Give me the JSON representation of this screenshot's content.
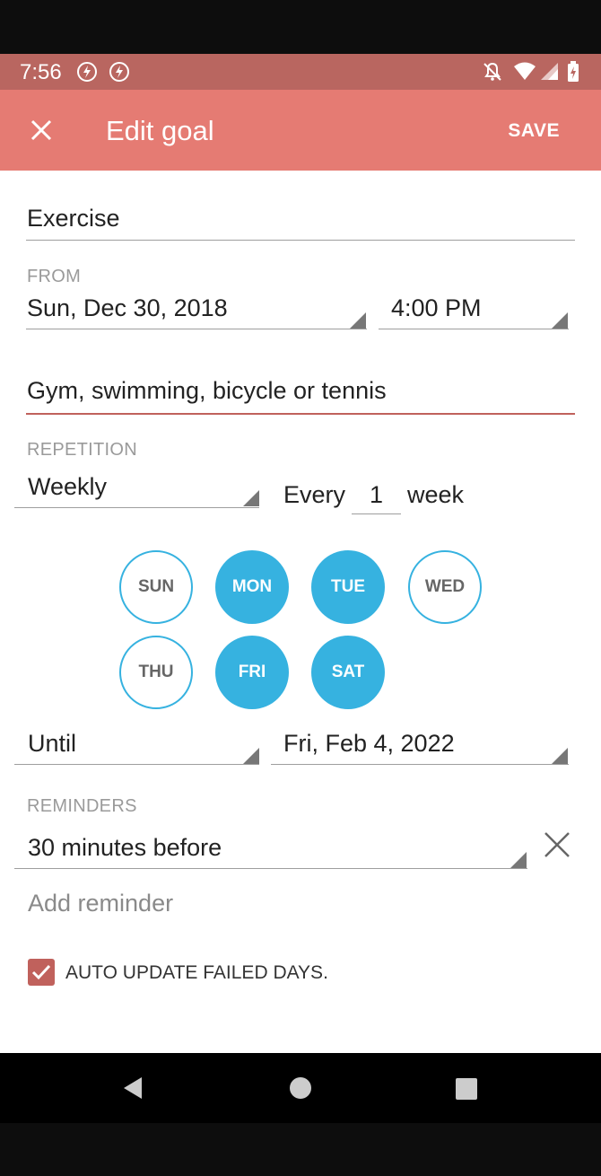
{
  "status_bar": {
    "time": "7:56",
    "icons": [
      "app-notification-icon",
      "app-notification-icon",
      "notifications-off-icon",
      "wifi-icon",
      "signal-icon",
      "battery-charging-icon"
    ]
  },
  "app_bar": {
    "title": "Edit goal",
    "save_label": "SAVE",
    "close_icon": "close-icon",
    "background_color": "#e57b73"
  },
  "form": {
    "goal_name": "Exercise",
    "from": {
      "label": "FROM",
      "date": "Sun, Dec 30, 2018",
      "time": "4:00 PM"
    },
    "description": "Gym, swimming, bicycle or tennis",
    "repetition": {
      "label": "REPETITION",
      "frequency": "Weekly",
      "every_label": "Every",
      "interval": "1",
      "unit": "week"
    },
    "days": [
      {
        "label": "SUN",
        "selected": false
      },
      {
        "label": "MON",
        "selected": true
      },
      {
        "label": "TUE",
        "selected": true
      },
      {
        "label": "WED",
        "selected": false
      },
      {
        "label": "THU",
        "selected": false
      },
      {
        "label": "FRI",
        "selected": true
      },
      {
        "label": "SAT",
        "selected": true
      }
    ],
    "until": {
      "mode": "Until",
      "date": "Fri, Feb 4, 2022"
    },
    "reminders": {
      "label": "REMINDERS",
      "items": [
        "30 minutes before"
      ],
      "add_label": "Add reminder"
    },
    "auto_update": {
      "label": "AUTO UPDATE FAILED DAYS.",
      "checked": true
    }
  },
  "colors": {
    "accent": "#c0615c",
    "day_selected": "#36b2e0",
    "status_bar": "#b96660"
  },
  "nav_bar": {
    "icons": [
      "back-icon",
      "home-icon",
      "recents-icon"
    ]
  }
}
